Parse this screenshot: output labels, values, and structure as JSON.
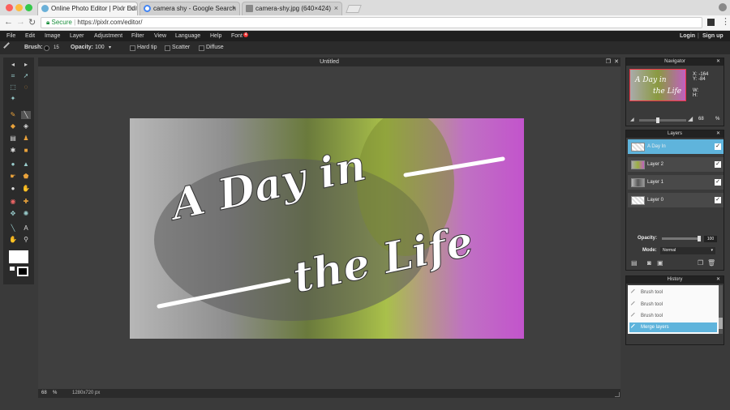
{
  "browser": {
    "tabs": [
      {
        "label": "Online Photo Editor | Pixlr Editor",
        "active": true
      },
      {
        "label": "camera shy - Google Search",
        "active": false
      },
      {
        "label": "camera-shy.jpg (640×424)",
        "active": false
      }
    ],
    "close_glyph": "×",
    "secure_label": "Secure",
    "url": "https://pixlr.com/editor/"
  },
  "menu": {
    "items": [
      "File",
      "Edit",
      "Image",
      "Layer",
      "Adjustment",
      "Filter",
      "View",
      "Language",
      "Help",
      "Font"
    ],
    "font_badge": "4",
    "login": "Login",
    "signup": "Sign up"
  },
  "options": {
    "brush_label": "Brush:",
    "brush_size": "15",
    "opacity_label": "Opacity:",
    "opacity_value": "100",
    "hard_tip": "Hard tip",
    "scatter": "Scatter",
    "diffuse": "Diffuse"
  },
  "document": {
    "title": "Untitled",
    "zoom": "68",
    "zoom_unit": "%",
    "size": "1280x720 px",
    "canvas_text_line1": "A Day in",
    "canvas_text_line2": "the Life"
  },
  "navigator": {
    "title": "Navigator",
    "x_label": "X:",
    "x_value": "-164",
    "y_label": "Y:",
    "y_value": "-84",
    "w_label": "W:",
    "h_label": "H:",
    "zoom_value": "68",
    "zoom_unit": "%",
    "zoom_fraction": 0.68
  },
  "layers": {
    "title": "Layers",
    "items": [
      {
        "label": "A Day In",
        "selected": true
      },
      {
        "label": "Layer 2",
        "selected": false
      },
      {
        "label": "Layer 1",
        "selected": false
      },
      {
        "label": "Layer 0",
        "selected": false
      }
    ],
    "check_glyph": "✓",
    "opacity_label": "Opacity:",
    "opacity_value": "100",
    "opacity_fraction": 1.0,
    "mode_label": "Mode:",
    "mode_value": "Normal"
  },
  "history": {
    "title": "History",
    "items": [
      "Brush tool",
      "Brush tool",
      "Brush tool",
      "Merge layers"
    ],
    "selected_index": 3
  },
  "colors": {
    "accent": "#5fb4dc",
    "foreground": "#ffffff",
    "background": "#000000"
  }
}
